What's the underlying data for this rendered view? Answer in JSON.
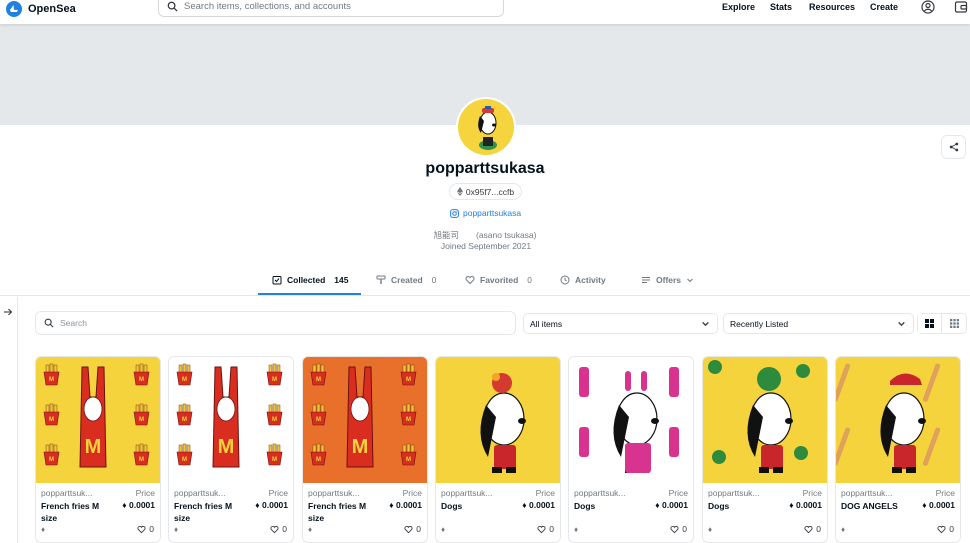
{
  "header": {
    "brand": "OpenSea",
    "search_placeholder": "Search items, collections, and accounts",
    "nav": [
      "Explore",
      "Stats",
      "Resources",
      "Create"
    ]
  },
  "profile": {
    "username": "popparttsukasa",
    "address": "0x95f7...ccfb",
    "instagram": "popparttsukasa",
    "bio": "旭能司　　(asano tsukasa)",
    "joined": "Joined September 2021"
  },
  "tabs": [
    {
      "label": "Collected",
      "count": "145",
      "active": true
    },
    {
      "label": "Created",
      "count": "0"
    },
    {
      "label": "Favorited",
      "count": "0"
    },
    {
      "label": "Activity",
      "count": ""
    },
    {
      "label": "Offers",
      "count": ""
    }
  ],
  "filters": {
    "search_placeholder": "Search",
    "items_select": "All items",
    "sort_select": "Recently Listed"
  },
  "cards": [
    {
      "owner": "popparttsuk...",
      "price_label": "Price",
      "name": "French fries M size",
      "price": "0.0001",
      "likes": "0",
      "bg": "#f5d33c",
      "art": "fries"
    },
    {
      "owner": "popparttsuk...",
      "price_label": "Price",
      "name": "French fries M size",
      "price": "0.0001",
      "likes": "0",
      "bg": "#ffffff",
      "art": "fries"
    },
    {
      "owner": "popparttsuk...",
      "price_label": "Price",
      "name": "French fries M size",
      "price": "0.0001",
      "likes": "0",
      "bg": "#e8702a",
      "art": "fries"
    },
    {
      "owner": "popparttsuk...",
      "price_label": "Price",
      "name": "Dogs",
      "price": "0.0001",
      "likes": "0",
      "bg": "#f5d33c",
      "art": "dog"
    },
    {
      "owner": "popparttsuk...",
      "price_label": "Price",
      "name": "Dogs",
      "price": "0.0001",
      "likes": "0",
      "bg": "#ffffff",
      "art": "dog-bunny"
    },
    {
      "owner": "popparttsuk...",
      "price_label": "Price",
      "name": "Dogs",
      "price": "0.0001",
      "likes": "0",
      "bg": "#f5d33c",
      "art": "dog-leaf"
    },
    {
      "owner": "popparttsuk...",
      "price_label": "Price",
      "name": "DOG ANGELS",
      "price": "0.0001",
      "likes": "0",
      "bg": "#f5d33c",
      "art": "dog-bat"
    }
  ],
  "colors": {
    "accent": "#2081e2",
    "banner": "#e5e8eb",
    "text": "#04111d",
    "muted": "#707a83"
  }
}
